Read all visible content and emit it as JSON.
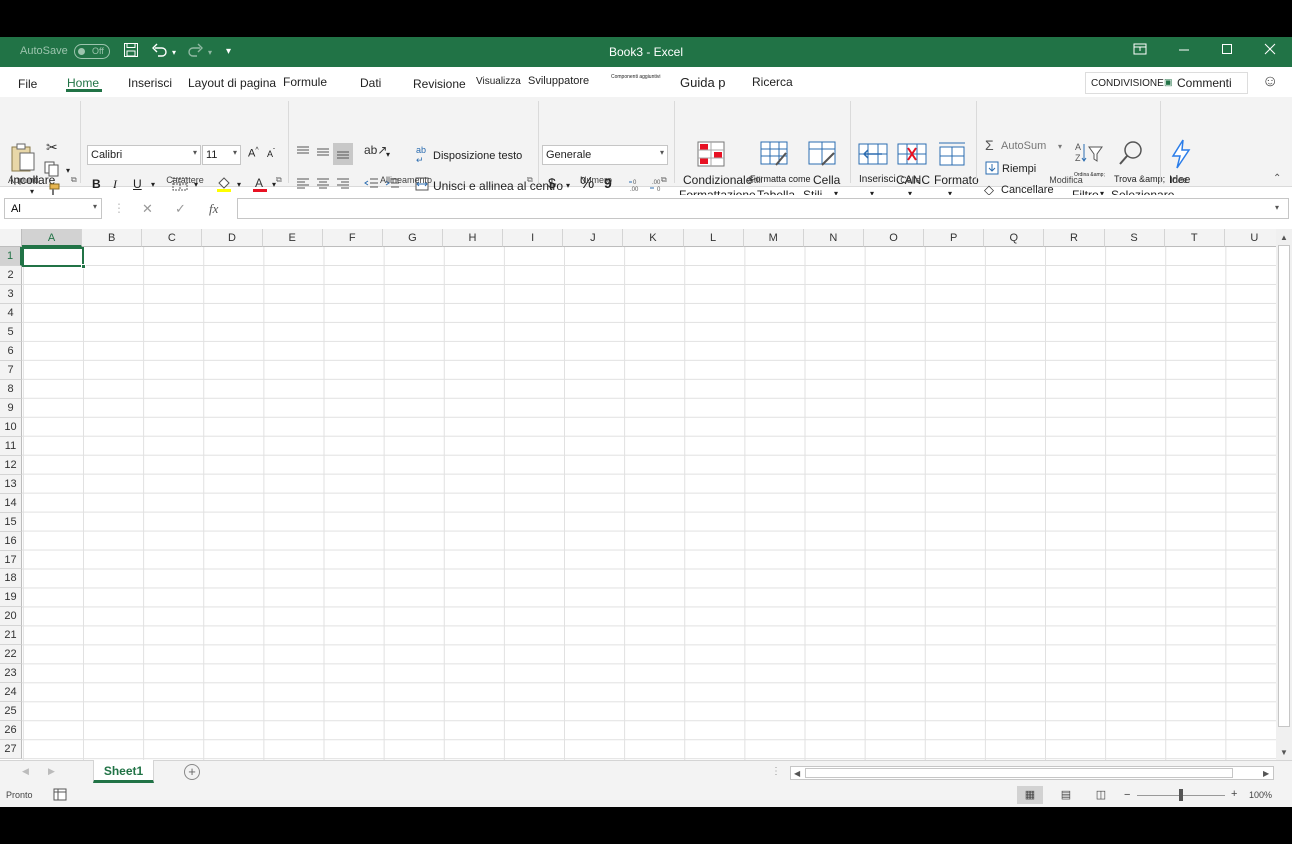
{
  "window": {
    "autosave_label": "AutoSave",
    "autosave_state": "Off",
    "title": "Book3  -  Excel"
  },
  "tabs": [
    "File",
    "Home",
    "Inserisci",
    "Layout di pagina",
    "Formule",
    "Dati",
    "Revisione",
    "Visualizza",
    "Sviluppatore",
    "Componenti aggiuntivi",
    "Guida p",
    "Ricerca"
  ],
  "share": {
    "share_label": "CONDIVISIONE",
    "comments_label": "Commenti"
  },
  "ribbon": {
    "clipboard": {
      "paste_label": "Incollare",
      "group_label": "Appunti"
    },
    "font": {
      "font_name": "Calibri",
      "font_size": "11",
      "bold": "B",
      "italic": "I",
      "underline": "U",
      "grow": "A",
      "shrink": "A",
      "group_label": "Carattere"
    },
    "alignment": {
      "wrap_text": "Disposizione testo",
      "merge_center": "Unisci e allinea al centro",
      "group_label": "Allineamento"
    },
    "number": {
      "format": "Generale",
      "currency": "$",
      "percent": "%",
      "comma": "9",
      "group_label": "Numero"
    },
    "styles": {
      "conditional_line1": "Condizionale",
      "conditional_line2": "Formattazione",
      "format_table_line1": "Formatta come",
      "format_table_line2": "Tabella",
      "cell_styles_line1": "Cella",
      "cell_styles_line2": "Stili",
      "group_label": "Stili"
    },
    "cells": {
      "insert": "Inserisci",
      "delete": "CANC",
      "format": "Formato",
      "group_label": "Celle"
    },
    "editing": {
      "autosum": "AutoSum",
      "fill": "Riempi",
      "clear": "Cancellare",
      "sort_small": "Ordina &amp;",
      "filter": "Filtro",
      "find_line1": "Trova &amp;",
      "find_line2": "Selezionare",
      "group_label": "Modifica"
    },
    "ideas": {
      "label": "Idee",
      "group_label": "Idee"
    }
  },
  "formula_bar": {
    "name_box": "Al",
    "cancel": "✕",
    "enter": "✓",
    "fx": "fx",
    "value": ""
  },
  "grid": {
    "columns": [
      "A",
      "B",
      "C",
      "D",
      "E",
      "F",
      "G",
      "H",
      "I",
      "J",
      "K",
      "L",
      "M",
      "N",
      "O",
      "P",
      "Q",
      "R",
      "S",
      "T",
      "U"
    ],
    "rows": [
      "1",
      "2",
      "3",
      "4",
      "5",
      "6",
      "7",
      "8",
      "9",
      "10",
      "11",
      "12",
      "13",
      "14",
      "15",
      "16",
      "17",
      "18",
      "19",
      "20",
      "21",
      "22",
      "23",
      "24",
      "25",
      "26",
      "27"
    ],
    "selected_cell": "A1"
  },
  "sheets": {
    "active": "Sheet1"
  },
  "status": {
    "ready": "Pronto",
    "zoom": "100%"
  },
  "colors": {
    "accent": "#217346",
    "ribbon_bg": "#f3f3f3",
    "gridline": "#e1e1e1"
  }
}
